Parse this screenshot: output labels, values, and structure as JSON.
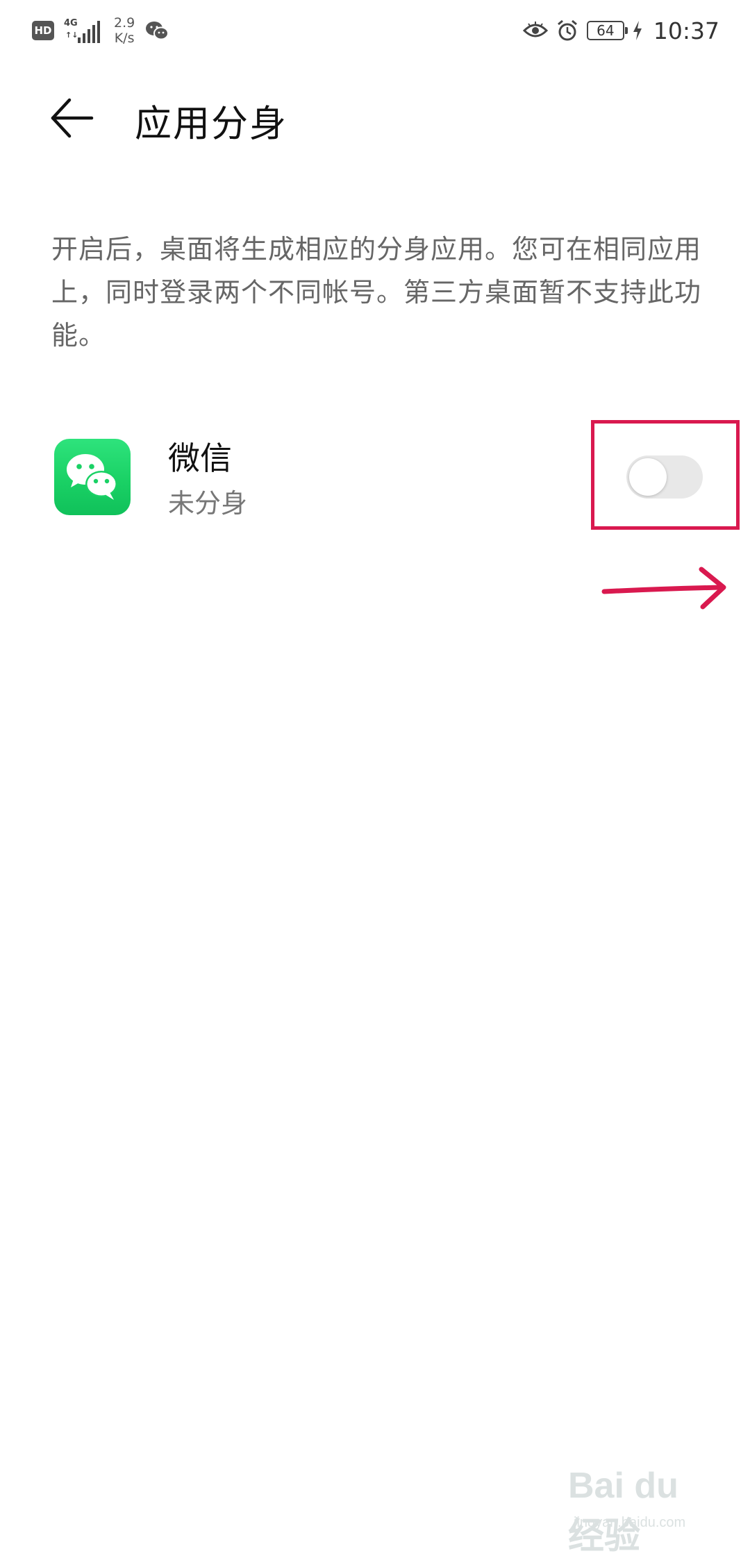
{
  "status_bar": {
    "hd_label": "HD",
    "network_type": "4G",
    "network_arrows": "↑↓",
    "speed_value": "2.9",
    "speed_unit": "K/s",
    "battery_level": "64",
    "time": "10:37",
    "icons": [
      "hd-icon",
      "signal-icon",
      "wechat-notification-icon",
      "eye-comfort-icon",
      "alarm-icon",
      "battery-icon",
      "charging-icon"
    ]
  },
  "header": {
    "title": "应用分身",
    "back_icon": "arrow-left-icon"
  },
  "description": "开启后，桌面将生成相应的分身应用。您可在相同应用上，同时登录两个不同帐号。第三方桌面暂不支持此功能。",
  "apps": [
    {
      "name": "微信",
      "status": "未分身",
      "icon": "wechat-app-icon",
      "toggle_on": false
    }
  ],
  "colors": {
    "accent_annotation": "#d9194f",
    "wechat_green": "#1ad165",
    "toggle_off_track": "#e8e8e8",
    "secondary_text": "#666666"
  },
  "watermark": {
    "logo_text": "Bai du 经验",
    "url": "jingyan.baidu.com"
  }
}
